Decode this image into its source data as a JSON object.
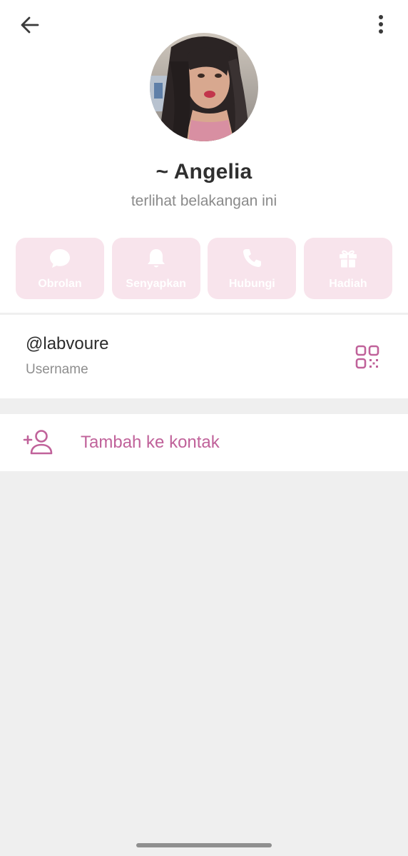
{
  "header": {
    "back_icon": "arrow-left-icon",
    "menu_icon": "more-vert-icon"
  },
  "profile": {
    "avatar": "profile-photo",
    "name": "~ Angelia",
    "last_seen": "terlihat belakangan ini"
  },
  "actions": [
    {
      "label": "Obrolan",
      "icon": "chat-bubble-icon"
    },
    {
      "label": "Senyapkan",
      "icon": "bell-icon"
    },
    {
      "label": "Hubungi",
      "icon": "phone-icon"
    },
    {
      "label": "Hadiah",
      "icon": "gift-icon"
    }
  ],
  "username": {
    "value": "@labvoure",
    "label": "Username",
    "qr_icon": "qr-code-icon"
  },
  "add_contact": {
    "label": "Tambah ke kontak",
    "icon": "add-person-icon"
  },
  "colors": {
    "accent": "#c0629a",
    "action_bg": "#f8e4ec",
    "background": "#efefef"
  }
}
